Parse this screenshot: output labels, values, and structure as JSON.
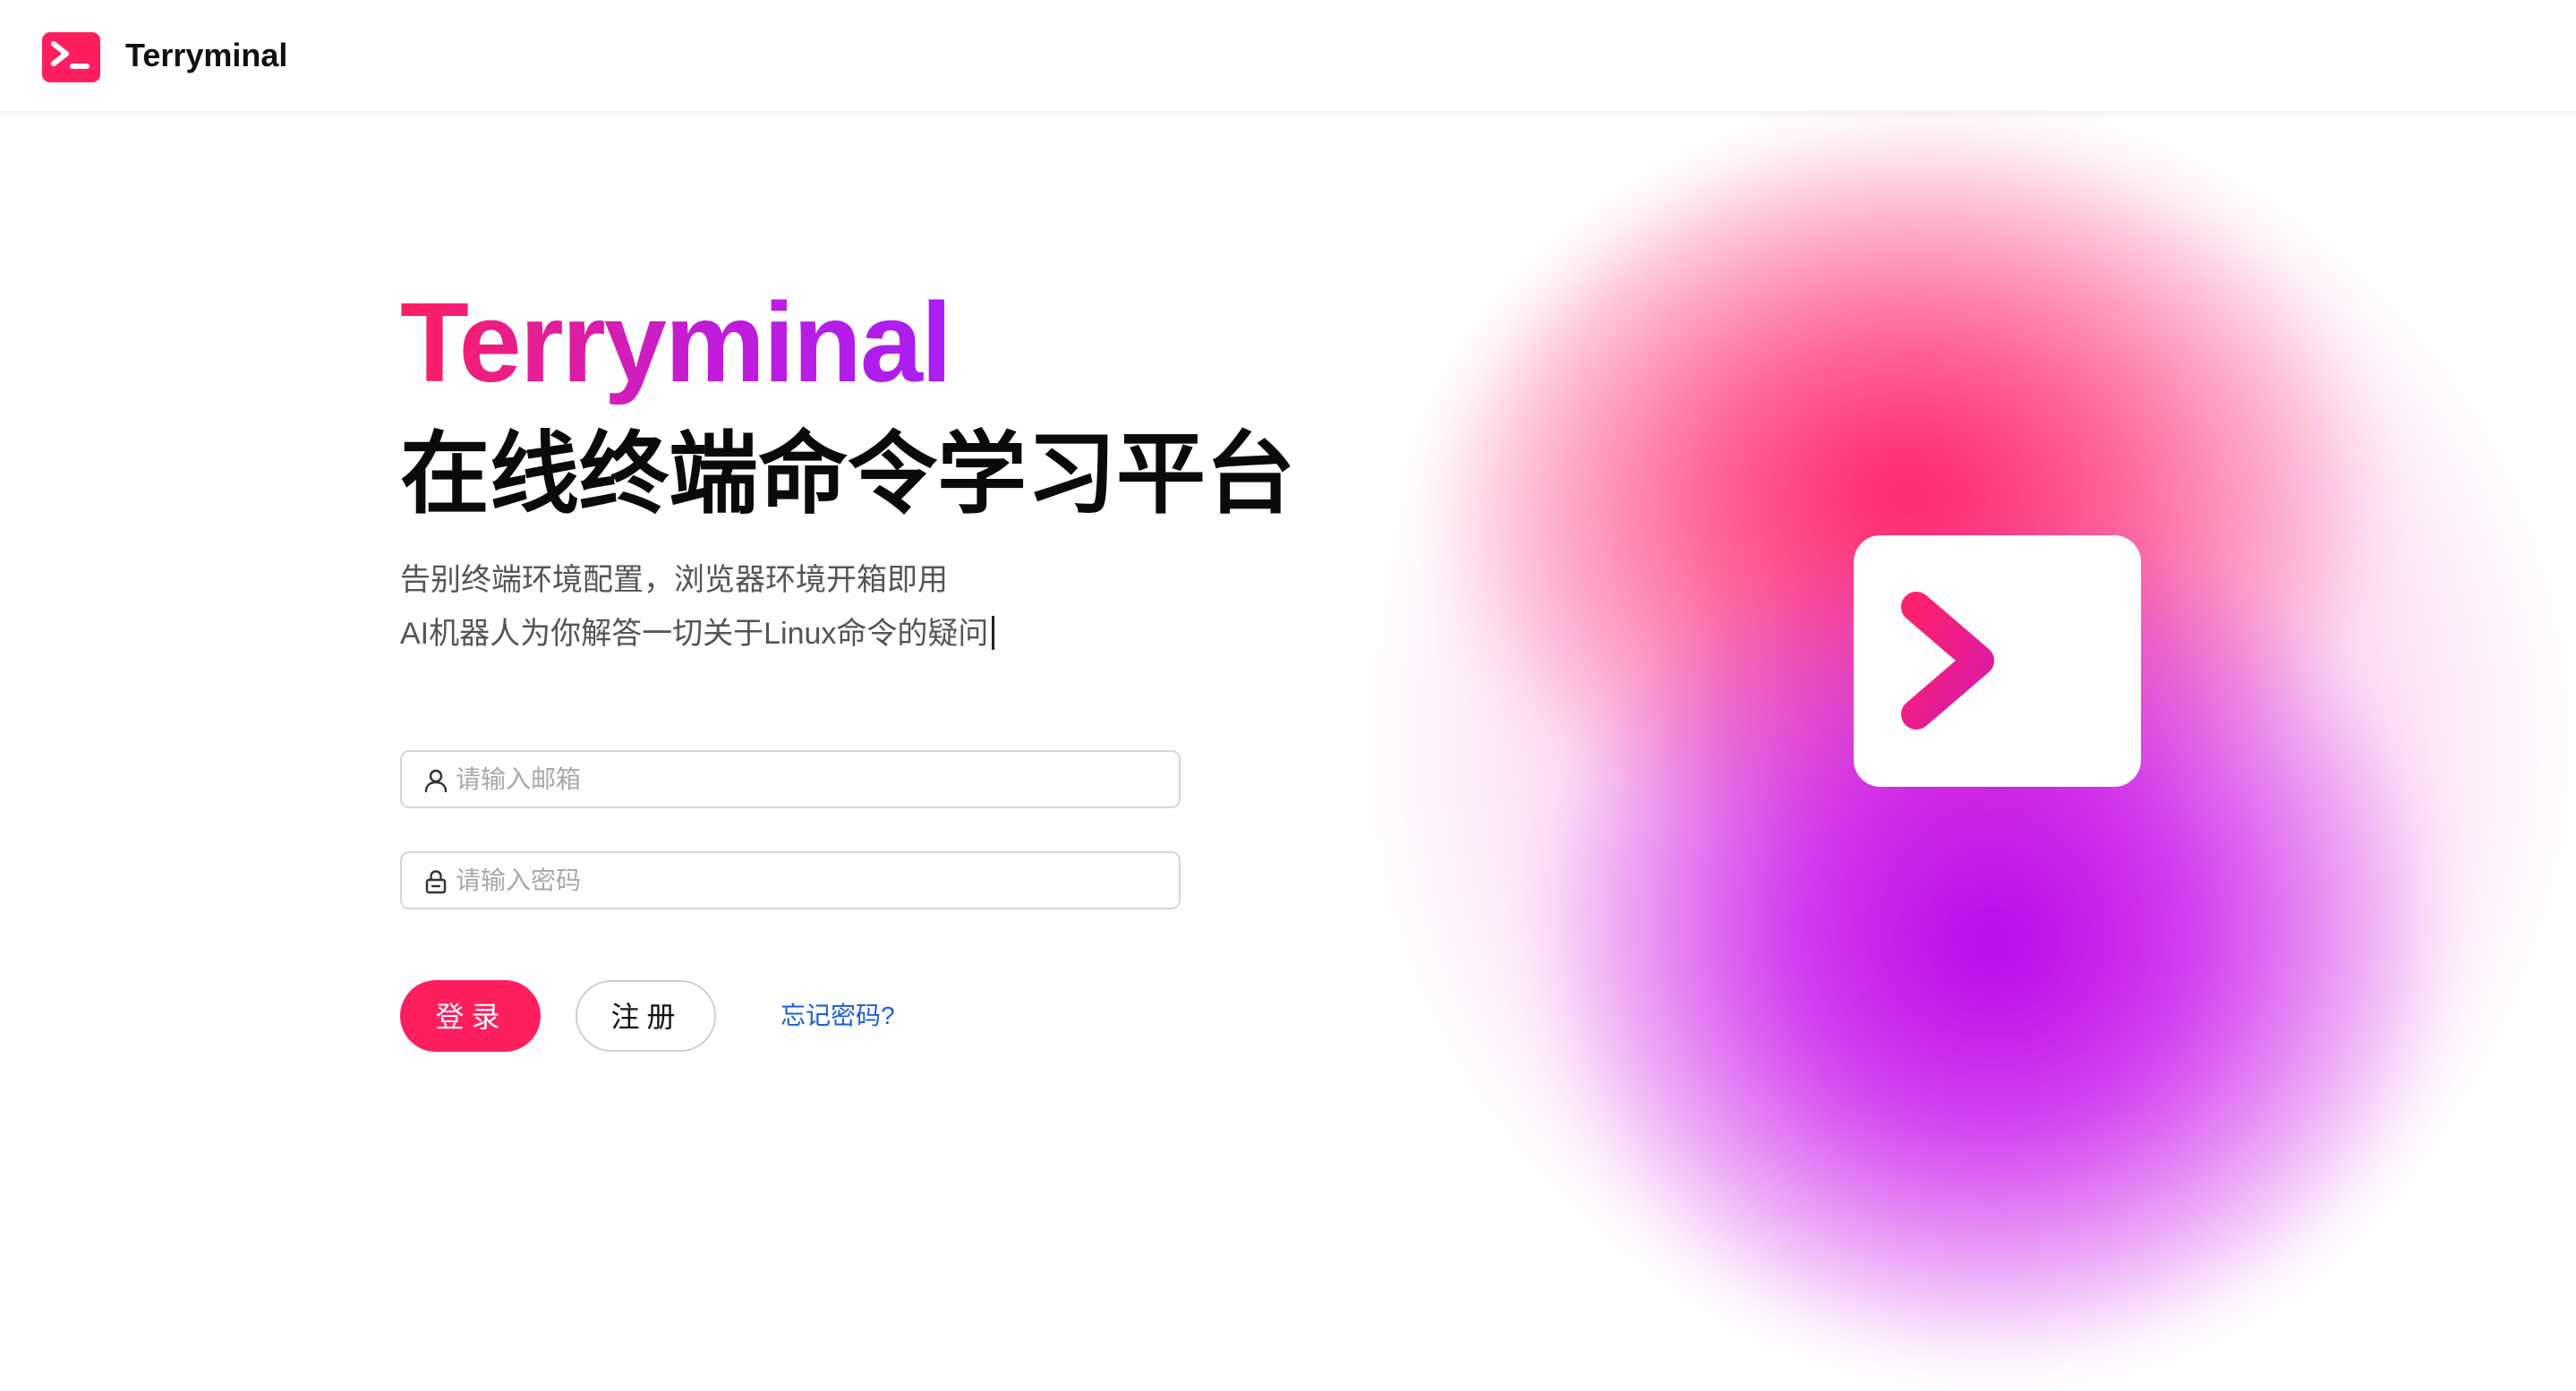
{
  "nav": {
    "brand": "Terryminal",
    "logo_icon": "terminal-prompt-icon"
  },
  "hero": {
    "title": "Terryminal",
    "subtitle": "在线终端命令学习平台",
    "description_line_1": "告别终端环境配置，浏览器环境开箱即用",
    "description_line_2": "AI机器人为你解答一切关于Linux命令的疑问",
    "illustration_icon": "terminal-prompt-icon"
  },
  "form": {
    "email": {
      "placeholder": "请输入邮箱",
      "value": "",
      "icon": "user-icon"
    },
    "password": {
      "placeholder": "请输入密码",
      "value": "",
      "icon": "lock-icon"
    },
    "login_label": "登录",
    "register_label": "注册",
    "forgot_label": "忘记密码?"
  },
  "colors": {
    "brand_pink": "#ff1f5e",
    "brand_purple": "#b400e6",
    "link_blue": "#1a5fd6"
  }
}
